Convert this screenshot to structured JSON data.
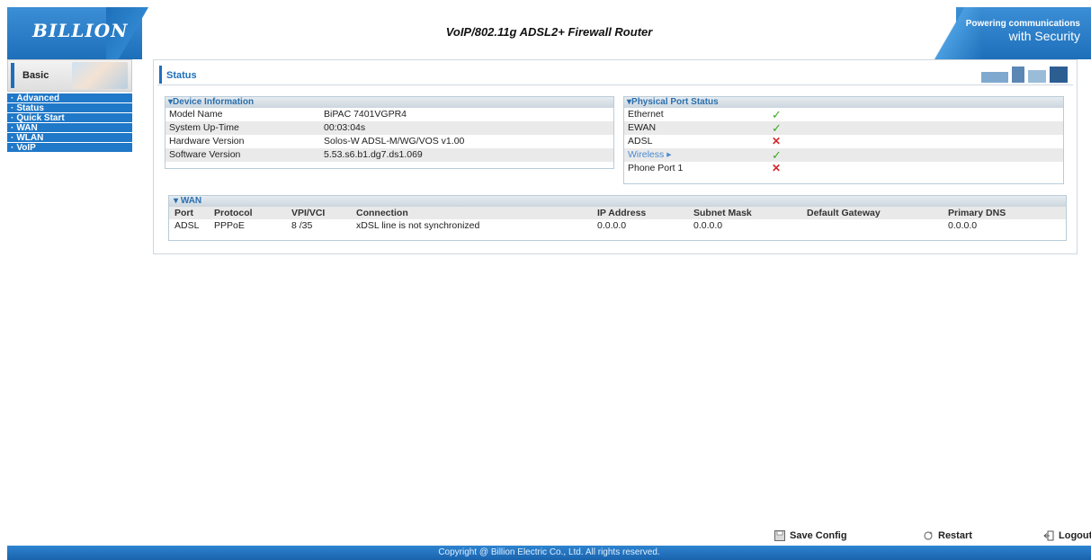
{
  "header": {
    "logo": "BILLION",
    "title": "VoIP/802.11g ADSL2+ Firewall Router",
    "tagline_top": "Powering communications",
    "tagline_bottom": "with Security"
  },
  "sidebar": {
    "basic_label": "Basic",
    "items": [
      {
        "label": "Advanced"
      },
      {
        "label": "Status"
      },
      {
        "label": "Quick Start"
      },
      {
        "label": "WAN"
      },
      {
        "label": "WLAN"
      },
      {
        "label": "VoIP"
      }
    ]
  },
  "status": {
    "title": "Status",
    "device": {
      "title": "Device Information",
      "rows": [
        {
          "k": "Model Name",
          "v": "BiPAC 7401VGPR4"
        },
        {
          "k": "System Up-Time",
          "v": "00:03:04s"
        },
        {
          "k": "Hardware Version",
          "v": "Solos-W ADSL-M/WG/VOS v1.00"
        },
        {
          "k": "Software Version",
          "v": "5.53.s6.b1.dg7.ds1.069"
        }
      ]
    },
    "ports": {
      "title": "Physical Port Status",
      "rows": [
        {
          "k": "Ethernet",
          "status": "ok"
        },
        {
          "k": "EWAN",
          "status": "ok"
        },
        {
          "k": "ADSL",
          "status": "down"
        },
        {
          "k": "Wireless",
          "status": "ok"
        },
        {
          "k": "Phone Port 1",
          "status": "down"
        }
      ]
    },
    "wan": {
      "title": "WAN",
      "columns": [
        "Port",
        "Protocol",
        "VPI/VCI",
        "Connection",
        "IP Address",
        "Subnet Mask",
        "Default Gateway",
        "Primary DNS"
      ],
      "row": [
        "ADSL",
        "PPPoE",
        "8 /35",
        "xDSL line is not synchronized",
        "0.0.0.0",
        "0.0.0.0",
        "",
        "0.0.0.0"
      ]
    }
  },
  "actions": {
    "save": "Save Config",
    "restart": "Restart",
    "logout": "Logout"
  },
  "footer": "Copyright @ Billion Electric Co., Ltd. All rights reserved.",
  "colors": {
    "accent": "#1e6fba",
    "ok": "#3aa81e",
    "down": "#d6262b"
  }
}
